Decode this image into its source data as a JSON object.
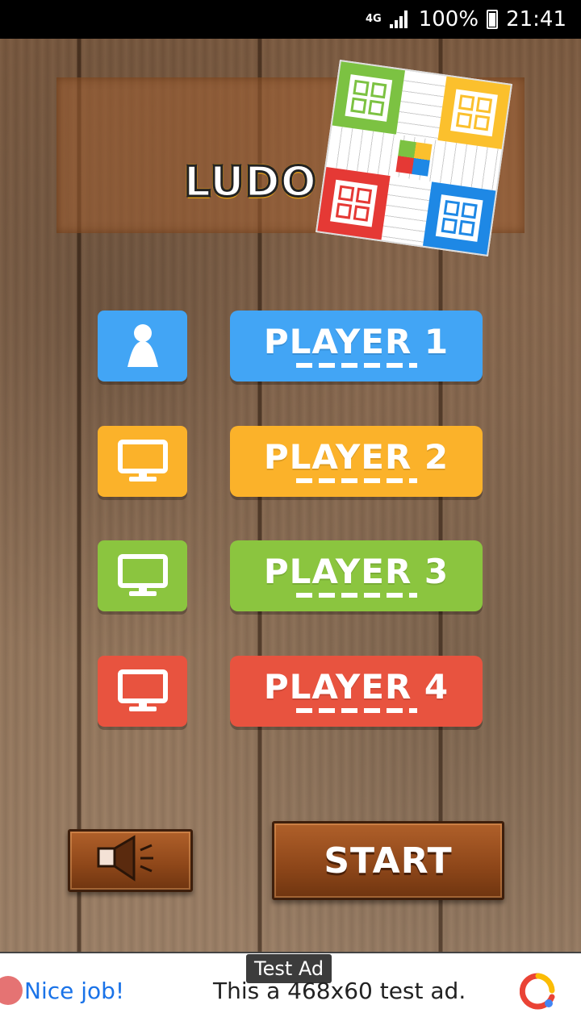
{
  "status_bar": {
    "network": "4G",
    "battery": "100%",
    "time": "21:41"
  },
  "title": {
    "logo": "LUDO"
  },
  "players": [
    {
      "label": "PLAYER 1",
      "type_icon": "person-icon",
      "color": "#42a5f5"
    },
    {
      "label": "PLAYER 2",
      "type_icon": "computer-icon",
      "color": "#fbb22a"
    },
    {
      "label": "PLAYER 3",
      "type_icon": "computer-icon",
      "color": "#8bc53f"
    },
    {
      "label": "PLAYER 4",
      "type_icon": "computer-icon",
      "color": "#e8533f"
    }
  ],
  "controls": {
    "sound_icon": "speaker-icon",
    "start_label": "START"
  },
  "ad": {
    "tag": "Test Ad",
    "headline": "Nice job!",
    "body": "This a 468x60 test ad."
  }
}
